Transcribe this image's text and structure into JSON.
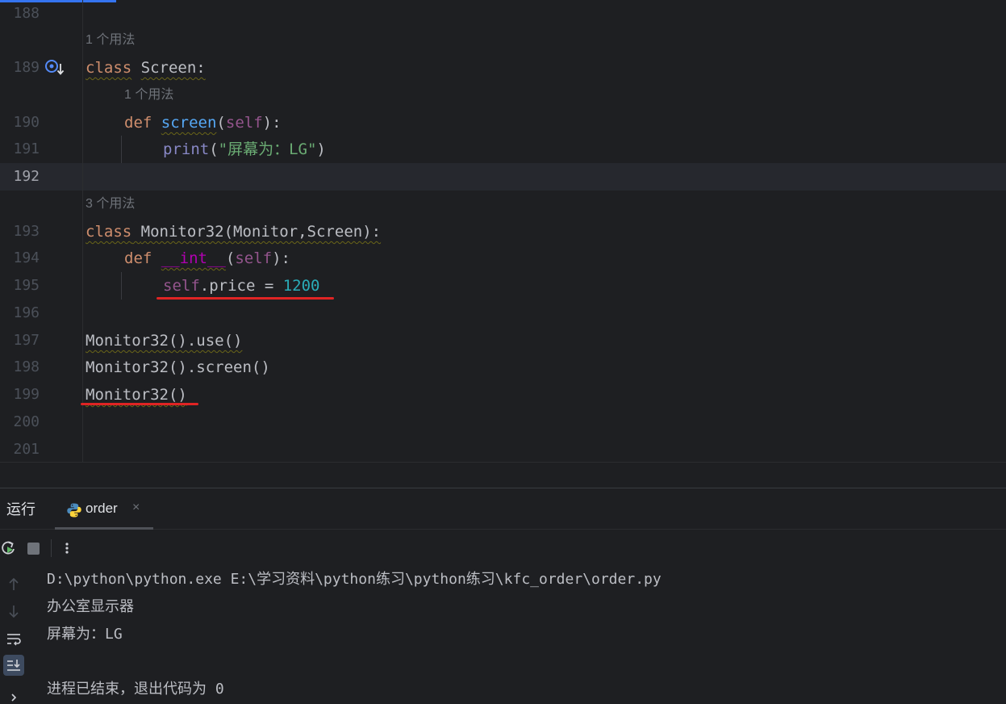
{
  "editor": {
    "lines": [
      {
        "num": "188"
      },
      {
        "num": "189"
      },
      {
        "num": "190"
      },
      {
        "num": "191"
      },
      {
        "num": "192"
      },
      {
        "num": "193"
      },
      {
        "num": "194"
      },
      {
        "num": "195"
      },
      {
        "num": "196"
      },
      {
        "num": "197"
      },
      {
        "num": "198"
      },
      {
        "num": "199"
      },
      {
        "num": "200"
      },
      {
        "num": "201"
      }
    ],
    "hints": {
      "screen_class_usages": "1 个用法",
      "screen_method_usages": "1 个用法",
      "monitor32_usages": "3 个用法"
    },
    "tokens": {
      "kw_class": "class",
      "kw_def": "def",
      "screen_class": "Screen:",
      "screen_method": "screen",
      "paren_open": "(",
      "self": "self",
      "paren_close_colon": "):",
      "print": "print",
      "print_open": "(",
      "print_str": "\"屏幕为：LG\"",
      "print_close": ")",
      "monitor32_class": "Monitor32(Monitor,Screen):",
      "init_name": "__int__",
      "price_attr": ".price = ",
      "price_value": "1200",
      "call_use": "Monitor32().use()",
      "call_screen": "Monitor32().screen()",
      "call_plain": "Monitor32()"
    }
  },
  "run_panel": {
    "title": "运行",
    "tab_label": "order",
    "tab_close": "×",
    "console_lines": [
      "D:\\python\\python.exe E:\\学习资料\\python练习\\python练习\\kfc_order\\order.py",
      "办公室显示器",
      "屏幕为：LG",
      "",
      "进程已结束，退出代码为 0"
    ]
  },
  "icons": {
    "gutter": "override-method-icon",
    "tab": "python-file-icon",
    "toolbar": [
      "rerun-icon",
      "stop-icon",
      "more-options-icon"
    ],
    "side": [
      "scroll-up-icon",
      "scroll-down-icon",
      "soft-wrap-icon",
      "scroll-to-end-icon",
      "expand-icon"
    ]
  },
  "colors": {
    "background": "#1e1f22",
    "current_line": "#26282e",
    "keyword": "#cf8e6d",
    "function": "#56a8f5",
    "self": "#94558d",
    "string": "#6aab73",
    "number": "#2aacb8",
    "annotation_red": "#e02424"
  }
}
